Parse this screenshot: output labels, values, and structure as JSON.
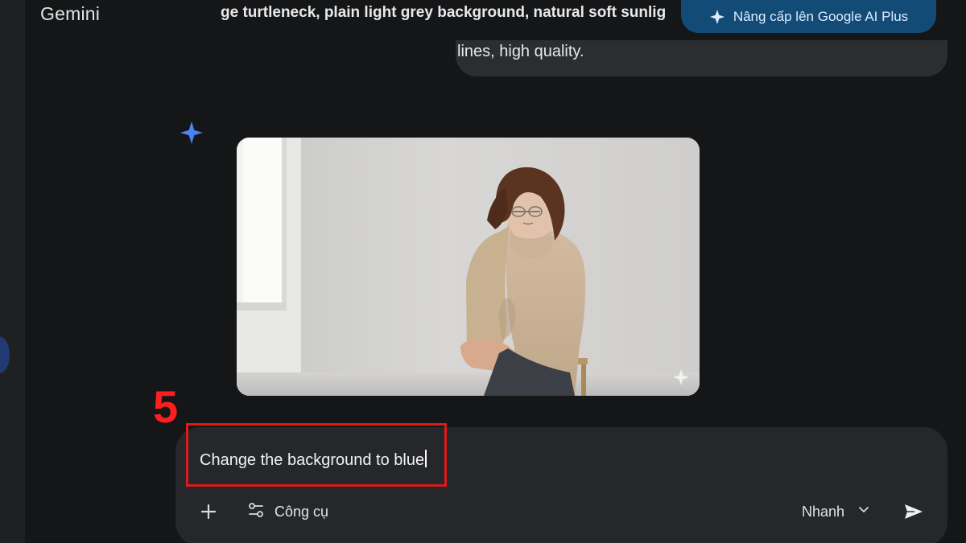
{
  "header": {
    "app_title": "Gemini",
    "prompt_excerpt": "ge turtleneck, plain light grey background, natural soft sunlig",
    "upgrade_label": "Nâng cấp lên Google AI Plus"
  },
  "user_message": {
    "tail_text": "lines, high quality."
  },
  "response": {
    "assistant_icon": "gemini-spark-icon",
    "image_icon": "spark-icon"
  },
  "annotation": {
    "step_number": "5"
  },
  "composer": {
    "input_value": "Change the background to blue",
    "add_icon": "plus-icon",
    "tools_label": "Công cụ",
    "tools_icon": "sliders-icon",
    "mode_label": "Nhanh",
    "mode_icon": "chevron-down-icon",
    "send_icon": "send-icon"
  },
  "colors": {
    "background": "#151618",
    "accent_blue": "#4f86f7",
    "upgrade_bg": "#134b77",
    "composer_bg": "#25272b",
    "annotation_red": "#e01919"
  }
}
